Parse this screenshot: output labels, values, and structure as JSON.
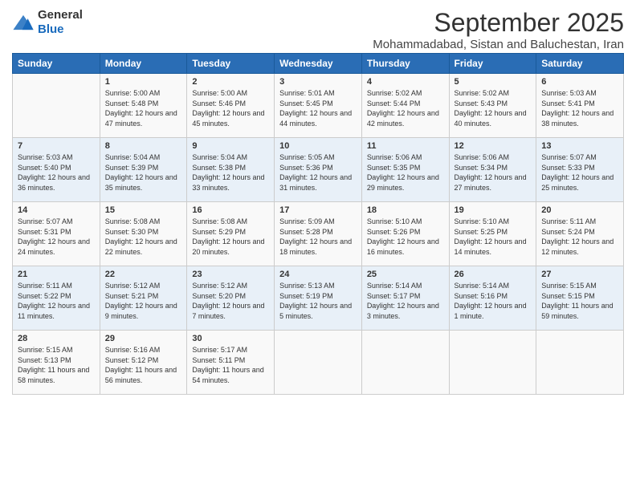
{
  "header": {
    "logo_general": "General",
    "logo_blue": "Blue",
    "month": "September 2025",
    "location": "Mohammadabad, Sistan and Baluchestan, Iran"
  },
  "weekdays": [
    "Sunday",
    "Monday",
    "Tuesday",
    "Wednesday",
    "Thursday",
    "Friday",
    "Saturday"
  ],
  "weeks": [
    [
      {
        "day": "",
        "sunrise": "",
        "sunset": "",
        "daylight": ""
      },
      {
        "day": "1",
        "sunrise": "Sunrise: 5:00 AM",
        "sunset": "Sunset: 5:48 PM",
        "daylight": "Daylight: 12 hours and 47 minutes."
      },
      {
        "day": "2",
        "sunrise": "Sunrise: 5:00 AM",
        "sunset": "Sunset: 5:46 PM",
        "daylight": "Daylight: 12 hours and 45 minutes."
      },
      {
        "day": "3",
        "sunrise": "Sunrise: 5:01 AM",
        "sunset": "Sunset: 5:45 PM",
        "daylight": "Daylight: 12 hours and 44 minutes."
      },
      {
        "day": "4",
        "sunrise": "Sunrise: 5:02 AM",
        "sunset": "Sunset: 5:44 PM",
        "daylight": "Daylight: 12 hours and 42 minutes."
      },
      {
        "day": "5",
        "sunrise": "Sunrise: 5:02 AM",
        "sunset": "Sunset: 5:43 PM",
        "daylight": "Daylight: 12 hours and 40 minutes."
      },
      {
        "day": "6",
        "sunrise": "Sunrise: 5:03 AM",
        "sunset": "Sunset: 5:41 PM",
        "daylight": "Daylight: 12 hours and 38 minutes."
      }
    ],
    [
      {
        "day": "7",
        "sunrise": "Sunrise: 5:03 AM",
        "sunset": "Sunset: 5:40 PM",
        "daylight": "Daylight: 12 hours and 36 minutes."
      },
      {
        "day": "8",
        "sunrise": "Sunrise: 5:04 AM",
        "sunset": "Sunset: 5:39 PM",
        "daylight": "Daylight: 12 hours and 35 minutes."
      },
      {
        "day": "9",
        "sunrise": "Sunrise: 5:04 AM",
        "sunset": "Sunset: 5:38 PM",
        "daylight": "Daylight: 12 hours and 33 minutes."
      },
      {
        "day": "10",
        "sunrise": "Sunrise: 5:05 AM",
        "sunset": "Sunset: 5:36 PM",
        "daylight": "Daylight: 12 hours and 31 minutes."
      },
      {
        "day": "11",
        "sunrise": "Sunrise: 5:06 AM",
        "sunset": "Sunset: 5:35 PM",
        "daylight": "Daylight: 12 hours and 29 minutes."
      },
      {
        "day": "12",
        "sunrise": "Sunrise: 5:06 AM",
        "sunset": "Sunset: 5:34 PM",
        "daylight": "Daylight: 12 hours and 27 minutes."
      },
      {
        "day": "13",
        "sunrise": "Sunrise: 5:07 AM",
        "sunset": "Sunset: 5:33 PM",
        "daylight": "Daylight: 12 hours and 25 minutes."
      }
    ],
    [
      {
        "day": "14",
        "sunrise": "Sunrise: 5:07 AM",
        "sunset": "Sunset: 5:31 PM",
        "daylight": "Daylight: 12 hours and 24 minutes."
      },
      {
        "day": "15",
        "sunrise": "Sunrise: 5:08 AM",
        "sunset": "Sunset: 5:30 PM",
        "daylight": "Daylight: 12 hours and 22 minutes."
      },
      {
        "day": "16",
        "sunrise": "Sunrise: 5:08 AM",
        "sunset": "Sunset: 5:29 PM",
        "daylight": "Daylight: 12 hours and 20 minutes."
      },
      {
        "day": "17",
        "sunrise": "Sunrise: 5:09 AM",
        "sunset": "Sunset: 5:28 PM",
        "daylight": "Daylight: 12 hours and 18 minutes."
      },
      {
        "day": "18",
        "sunrise": "Sunrise: 5:10 AM",
        "sunset": "Sunset: 5:26 PM",
        "daylight": "Daylight: 12 hours and 16 minutes."
      },
      {
        "day": "19",
        "sunrise": "Sunrise: 5:10 AM",
        "sunset": "Sunset: 5:25 PM",
        "daylight": "Daylight: 12 hours and 14 minutes."
      },
      {
        "day": "20",
        "sunrise": "Sunrise: 5:11 AM",
        "sunset": "Sunset: 5:24 PM",
        "daylight": "Daylight: 12 hours and 12 minutes."
      }
    ],
    [
      {
        "day": "21",
        "sunrise": "Sunrise: 5:11 AM",
        "sunset": "Sunset: 5:22 PM",
        "daylight": "Daylight: 12 hours and 11 minutes."
      },
      {
        "day": "22",
        "sunrise": "Sunrise: 5:12 AM",
        "sunset": "Sunset: 5:21 PM",
        "daylight": "Daylight: 12 hours and 9 minutes."
      },
      {
        "day": "23",
        "sunrise": "Sunrise: 5:12 AM",
        "sunset": "Sunset: 5:20 PM",
        "daylight": "Daylight: 12 hours and 7 minutes."
      },
      {
        "day": "24",
        "sunrise": "Sunrise: 5:13 AM",
        "sunset": "Sunset: 5:19 PM",
        "daylight": "Daylight: 12 hours and 5 minutes."
      },
      {
        "day": "25",
        "sunrise": "Sunrise: 5:14 AM",
        "sunset": "Sunset: 5:17 PM",
        "daylight": "Daylight: 12 hours and 3 minutes."
      },
      {
        "day": "26",
        "sunrise": "Sunrise: 5:14 AM",
        "sunset": "Sunset: 5:16 PM",
        "daylight": "Daylight: 12 hours and 1 minute."
      },
      {
        "day": "27",
        "sunrise": "Sunrise: 5:15 AM",
        "sunset": "Sunset: 5:15 PM",
        "daylight": "Daylight: 11 hours and 59 minutes."
      }
    ],
    [
      {
        "day": "28",
        "sunrise": "Sunrise: 5:15 AM",
        "sunset": "Sunset: 5:13 PM",
        "daylight": "Daylight: 11 hours and 58 minutes."
      },
      {
        "day": "29",
        "sunrise": "Sunrise: 5:16 AM",
        "sunset": "Sunset: 5:12 PM",
        "daylight": "Daylight: 11 hours and 56 minutes."
      },
      {
        "day": "30",
        "sunrise": "Sunrise: 5:17 AM",
        "sunset": "Sunset: 5:11 PM",
        "daylight": "Daylight: 11 hours and 54 minutes."
      },
      {
        "day": "",
        "sunrise": "",
        "sunset": "",
        "daylight": ""
      },
      {
        "day": "",
        "sunrise": "",
        "sunset": "",
        "daylight": ""
      },
      {
        "day": "",
        "sunrise": "",
        "sunset": "",
        "daylight": ""
      },
      {
        "day": "",
        "sunrise": "",
        "sunset": "",
        "daylight": ""
      }
    ]
  ]
}
